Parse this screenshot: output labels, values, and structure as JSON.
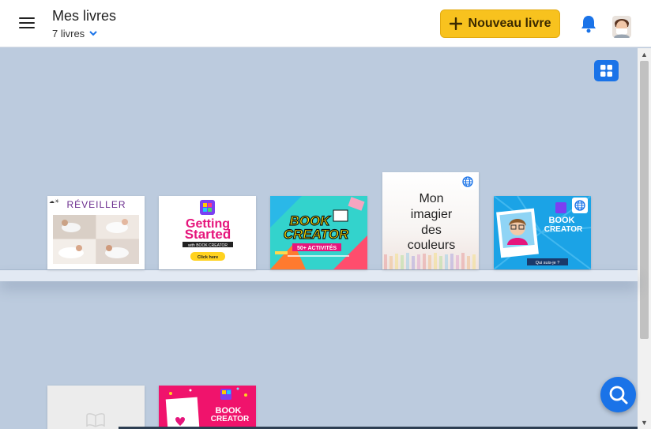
{
  "header": {
    "title": "Mes livres",
    "book_count": "7 livres",
    "new_book_label": "Nouveau livre"
  },
  "colors": {
    "accent": "#1a73e8",
    "new_button": "#f8c21e",
    "background": "#bccbde"
  },
  "books": [
    {
      "title_lines": [
        "RÉVEILLER"
      ],
      "published": false
    },
    {
      "title_lines": [
        "Getting",
        "Started",
        "with BOOK CREATOR",
        "Click here"
      ],
      "published": false
    },
    {
      "title_lines": [
        "BOOK",
        "CREATOR",
        "50+ ACTIVITÉS"
      ],
      "published": false
    },
    {
      "title_lines": [
        "Mon",
        "imagier",
        "des",
        "couleurs"
      ],
      "published": true
    },
    {
      "title_lines": [
        "BOOK",
        "CREATOR",
        "Qui suis-je ?"
      ],
      "published": true
    },
    {
      "title_lines": [],
      "published": false
    },
    {
      "title_lines": [
        "BOOK",
        "CREATOR"
      ],
      "published": false
    }
  ]
}
